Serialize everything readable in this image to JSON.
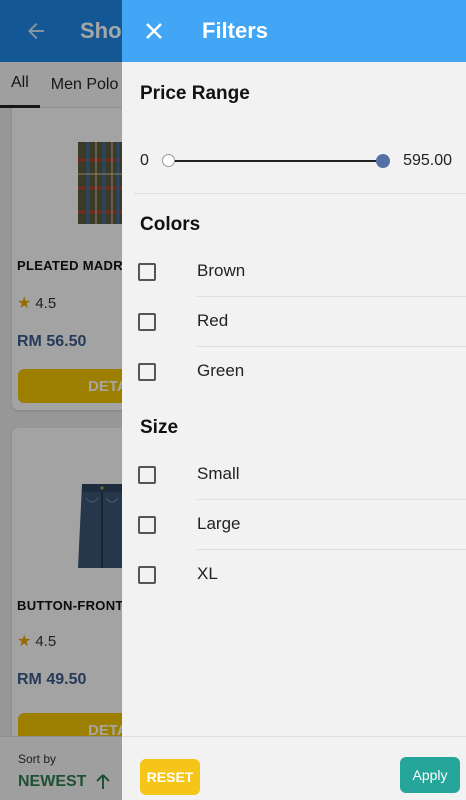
{
  "app_bar": {
    "title": "Sho"
  },
  "tabs": [
    {
      "label": "All"
    },
    {
      "label": "Men Polo"
    }
  ],
  "products": [
    {
      "name": "PLEATED MADR",
      "rating": "4.5",
      "price": "RM 56.50",
      "button": "DETA",
      "image": "plaid-skirt"
    },
    {
      "name": "BUTTON-FRONT",
      "rating": "4.5",
      "price": "RM 49.50",
      "button": "DETA",
      "image": "denim-skirt"
    }
  ],
  "sort": {
    "label": "Sort by",
    "value": "NEWEST"
  },
  "filters": {
    "title": "Filters",
    "price_range": {
      "title": "Price Range",
      "min_label": "0",
      "max_label": "595.00",
      "min_value": 0,
      "max_value": 595.0
    },
    "colors": {
      "title": "Colors",
      "options": [
        "Brown",
        "Red",
        "Green"
      ]
    },
    "size": {
      "title": "Size",
      "options": [
        "Small",
        "Large",
        "XL"
      ]
    },
    "reset_label": "RESET",
    "apply_label": "Apply"
  },
  "colors": {
    "app_bar": "#1e88e5",
    "drawer_header": "#42a5f5",
    "reset_button": "#f5c518",
    "apply_button": "#26a69a",
    "price_text": "#3b5a8a",
    "sort_text": "#2e7d4f"
  }
}
